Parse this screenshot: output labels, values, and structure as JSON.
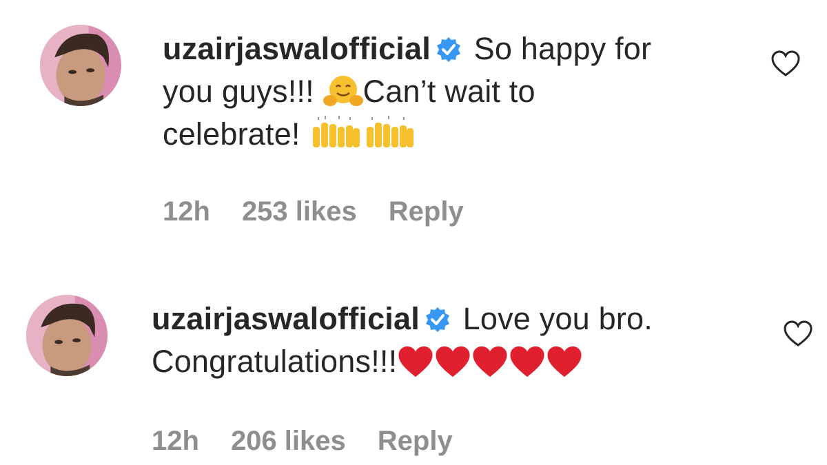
{
  "comments": [
    {
      "username": "uzairjaswalofficial",
      "text_line1": "So happy for",
      "text_line2a": "you guys!!!",
      "text_line2b": "Can’t wait to",
      "text_line3": "celebrate!",
      "emojis": [
        "hugging-face-icon",
        "raised-hands-icon",
        "raised-hands-icon"
      ],
      "time": "12h",
      "likes": "253 likes",
      "reply": "Reply"
    },
    {
      "username": "uzairjaswalofficial",
      "text_line1": "Love you bro.",
      "text_line2": "Congratulations!!!",
      "emojis": [
        "red-heart-icon",
        "red-heart-icon",
        "red-heart-icon",
        "red-heart-icon",
        "red-heart-icon"
      ],
      "time": "12h",
      "likes": "206 likes",
      "reply": "Reply"
    }
  ],
  "colors": {
    "verified": "#3897f0",
    "meta_gray": "#8e8e8e",
    "text": "#262626",
    "emoji_yellow": "#f6c02e",
    "heart_red": "#e0202e"
  }
}
